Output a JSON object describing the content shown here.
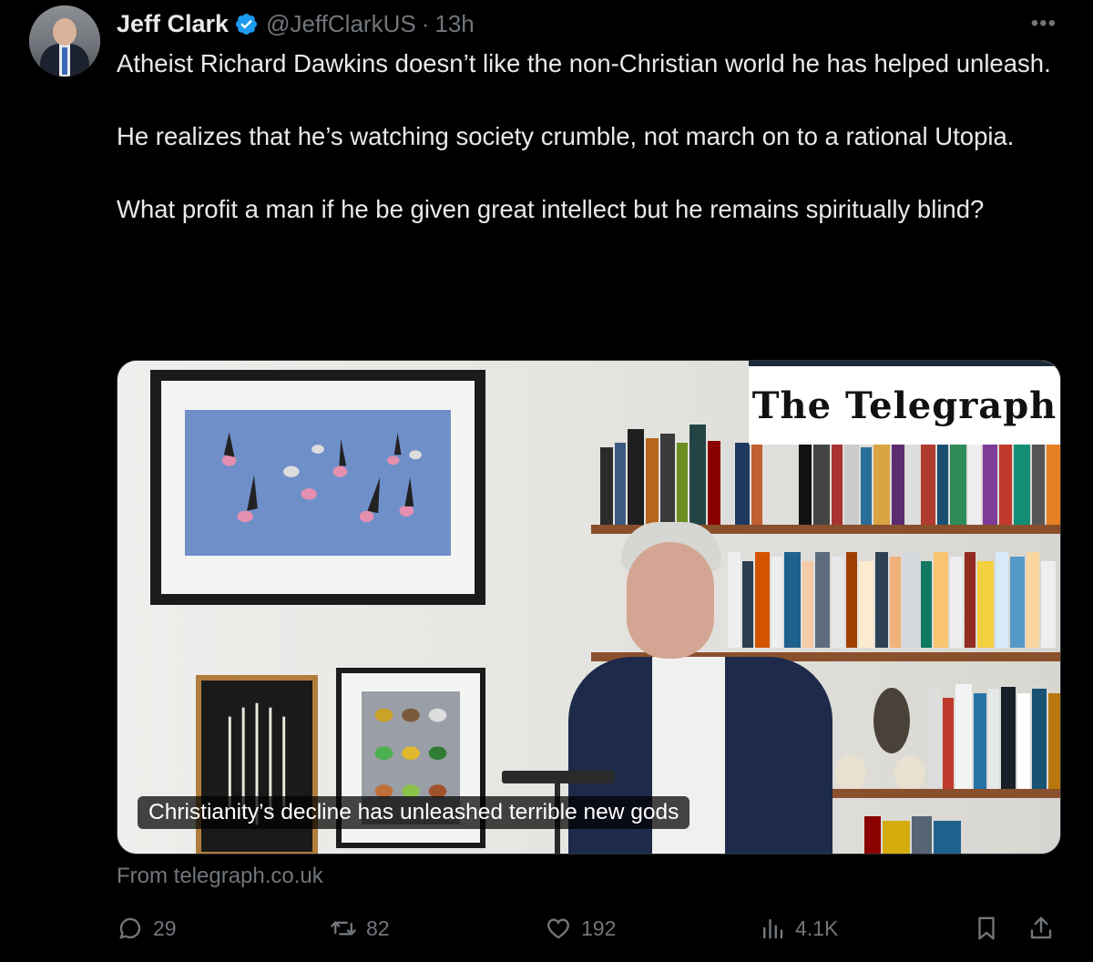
{
  "post": {
    "author_name": "Jeff Clark",
    "handle": "@JeffClarkUS",
    "separator": "·",
    "time": "13h",
    "more_icon": "ellipsis-icon",
    "verified_icon": "verified-badge-icon",
    "paragraphs": [
      "Atheist Richard Dawkins doesn’t like the non-Christian world he has helped unleash.",
      "He realizes that he’s watching society crumble, not march on to a rational Utopia.",
      "What profit a man if he be given great intellect but he remains spiritually blind?"
    ]
  },
  "card": {
    "brand": "The Telegraph",
    "caption": "Christianity’s decline has unleashed terrible new gods",
    "source": "From telegraph.co.uk"
  },
  "actions": {
    "replies": "29",
    "reposts": "82",
    "likes": "192",
    "views": "4.1K"
  },
  "colors": {
    "background": "#000000",
    "text": "#e7e9ea",
    "muted": "#71767b",
    "verified": "#1d9bf0"
  }
}
